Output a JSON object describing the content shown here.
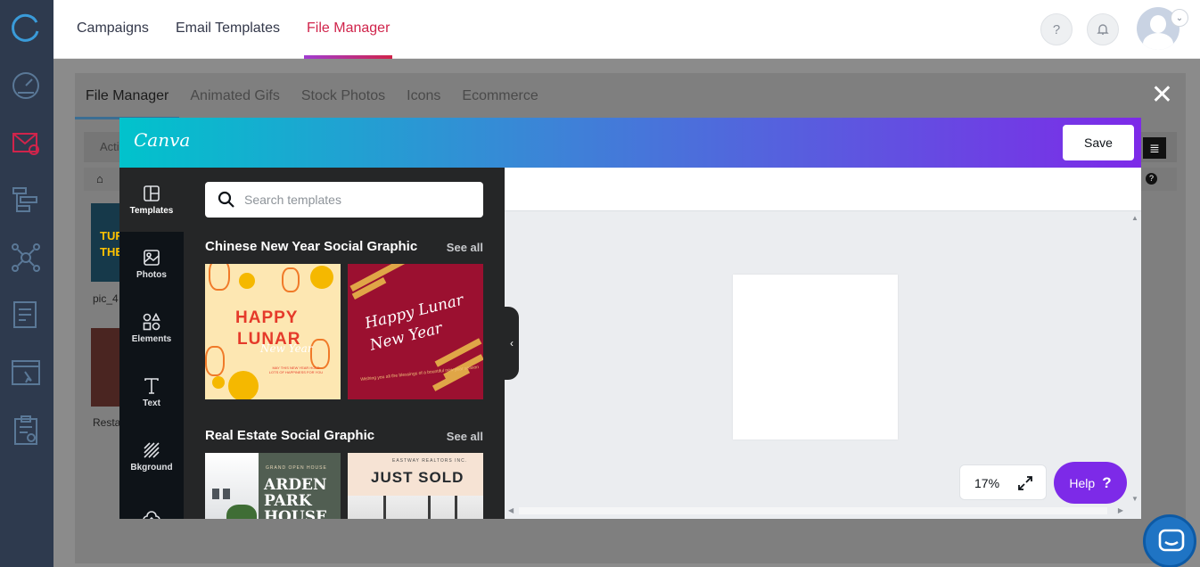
{
  "header": {
    "tabs": [
      {
        "label": "Campaigns",
        "active": false
      },
      {
        "label": "Email Templates",
        "active": false
      },
      {
        "label": "File Manager",
        "active": true
      }
    ],
    "help_icon": "?",
    "active_tab_color": "#d0244b"
  },
  "sidebar": {
    "icons": [
      "logo-ring-icon",
      "dashboard-icon",
      "email-campaign-icon",
      "flow-icon",
      "network-icon",
      "contacts-icon",
      "landing-page-icon",
      "forms-icon"
    ],
    "background": "#2e3a4e"
  },
  "file_manager": {
    "tabs": [
      {
        "label": "File Manager",
        "active": true
      },
      {
        "label": "Animated Gifs",
        "active": false
      },
      {
        "label": "Stock Photos",
        "active": false
      },
      {
        "label": "Icons",
        "active": false
      },
      {
        "label": "Ecommerce",
        "active": false
      }
    ],
    "close_icon": "✕",
    "toolbar_label": "Acti",
    "files": [
      {
        "name": "pic_4",
        "thumb_text": "TURN THE"
      },
      {
        "name": "Resta"
      }
    ]
  },
  "canva": {
    "logo": "Canva",
    "save_label": "Save",
    "rail": [
      {
        "label": "Templates",
        "active": true
      },
      {
        "label": "Photos",
        "active": false
      },
      {
        "label": "Elements",
        "active": false
      },
      {
        "label": "Text",
        "active": false
      },
      {
        "label": "Bkground",
        "active": false
      }
    ],
    "search_placeholder": "Search templates",
    "sections": [
      {
        "title": "Chinese New Year Social Graphic",
        "see_all": "See all",
        "cards": [
          {
            "line1": "HAPPY",
            "line2": "LUNAR",
            "line3": "New Year",
            "small": "MAY THIS NEW YEAR HOLD LOTS OF HAPPINESS FOR YOU"
          },
          {
            "line1": "Happy Lunar",
            "line2": "New Year",
            "small": "Wishing you all the blessings of a bountiful new year season"
          }
        ]
      },
      {
        "title": "Real Estate Social Graphic",
        "see_all": "See all",
        "cards": [
          {
            "small": "GRAND OPEN HOUSE",
            "big": [
              "ARDEN",
              "PARK",
              "HOUSE"
            ]
          },
          {
            "small": "EASTWAY REALTORS INC.",
            "big": "JUST SOLD"
          }
        ]
      }
    ],
    "zoom": "17%",
    "help_label": "Help",
    "help_icon": "?",
    "brand_purple": "#7d2ae8",
    "brand_teal": "#01c3cc"
  }
}
